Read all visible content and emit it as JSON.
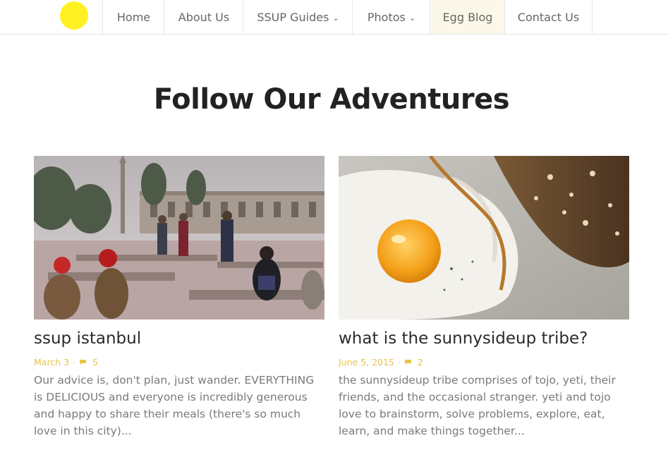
{
  "nav": {
    "items": [
      {
        "label": "Home"
      },
      {
        "label": "About Us"
      },
      {
        "label": "SSUP Guides"
      },
      {
        "label": "Photos"
      },
      {
        "label": "Egg Blog"
      },
      {
        "label": "Contact Us"
      }
    ]
  },
  "colors": {
    "logo": "#fff021",
    "meta": "#e8c44a",
    "active_nav": "#fbf8ea"
  },
  "page_title": "Follow Our Adventures",
  "posts": [
    {
      "title": "ssup istanbul",
      "date": "March 3",
      "comments": "5",
      "excerpt": "Our advice is, don't plan, just wander. EVERYTHING is DELICIOUS and everyone is incredibly generous and happy to share their meals (there's so much love in this city)..."
    },
    {
      "title": "what is the sunnysideup tribe?",
      "date": "June 5, 2015",
      "comments": "2",
      "excerpt": "the sunnysideup tribe comprises of tojo, yeti, their friends, and the occasional stranger. yeti and tojo love to brainstorm, solve problems, explore, eat, learn, and make things together..."
    }
  ]
}
